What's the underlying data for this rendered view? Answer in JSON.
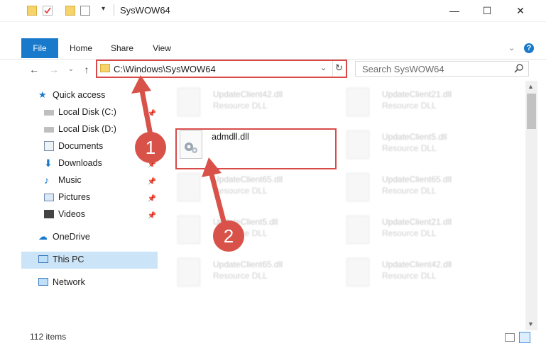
{
  "window": {
    "title": "SysWOW64",
    "minimize_glyph": "—",
    "maximize_glyph": "☐",
    "close_glyph": "✕"
  },
  "ribbon": {
    "file": "File",
    "tabs": [
      "Home",
      "Share",
      "View"
    ],
    "help": "?"
  },
  "address": {
    "path": "C:\\Windows\\SysWOW64",
    "search_placeholder": "Search SysWOW64"
  },
  "sidebar": {
    "items": [
      {
        "label": "Quick access",
        "icon": "star-icon"
      },
      {
        "label": "Local Disk (C:)",
        "icon": "drive-icon"
      },
      {
        "label": "Local Disk (D:)",
        "icon": "drive-icon"
      },
      {
        "label": "Documents",
        "icon": "document-icon"
      },
      {
        "label": "Downloads",
        "icon": "download-icon"
      },
      {
        "label": "Music",
        "icon": "music-icon"
      },
      {
        "label": "Pictures",
        "icon": "picture-icon"
      },
      {
        "label": "Videos",
        "icon": "video-icon"
      },
      {
        "label": "OneDrive",
        "icon": "cloud-icon"
      },
      {
        "label": "This PC",
        "icon": "computer-icon"
      },
      {
        "label": "Network",
        "icon": "network-icon"
      }
    ]
  },
  "files": {
    "highlighted": {
      "name": "admdll.dll"
    },
    "blurred": [
      {
        "name": "UpdateClient42.dll",
        "type": "Resource DLL"
      },
      {
        "name": "UpdateClient21.dll",
        "type": "Resource DLL"
      },
      {
        "name": "UpdateClient5.dll",
        "type": "Resource DLL"
      },
      {
        "name": "UpdateClient65.dll",
        "type": "Resource DLL"
      },
      {
        "name": "UpdateClient65.dll",
        "type": "Resource DLL"
      },
      {
        "name": "UpdateClient5.dll",
        "type": "Resource DLL"
      },
      {
        "name": "UpdateClient21.dll",
        "type": "Resource DLL"
      },
      {
        "name": "UpdateClient65.dll",
        "type": "Resource DLL"
      },
      {
        "name": "UpdateClient42.dll",
        "type": "Resource DLL"
      }
    ]
  },
  "status": {
    "count": "112 items"
  },
  "callouts": {
    "one": "1",
    "two": "2"
  },
  "colors": {
    "accent": "#1979ca",
    "highlight": "#d84a4a",
    "selected": "#cce4f7"
  }
}
